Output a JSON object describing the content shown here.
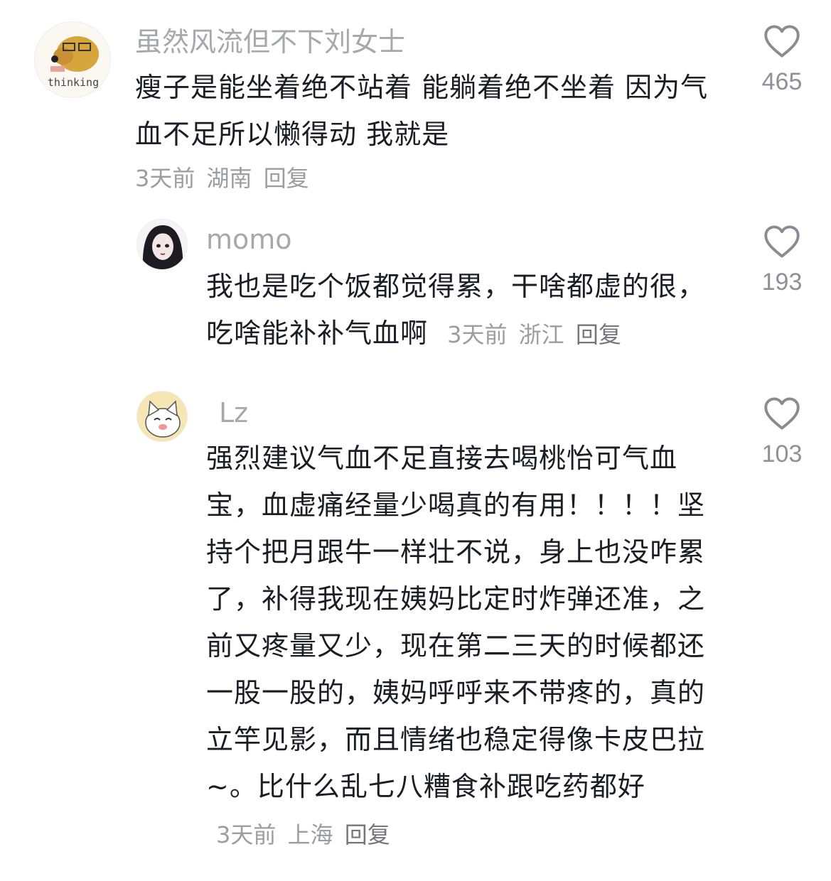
{
  "comments": [
    {
      "username": "虽然风流但不下刘女士",
      "avatar_text": "thinking",
      "text": "瘦子是能坐着绝不站着 能躺着绝不坐着  因为气血不足所以懒得动  我就是",
      "time": "3天前",
      "location": "湖南",
      "reply_label": "回复",
      "likes": "465"
    },
    {
      "username": "momo",
      "text": "我也是吃个饭都觉得累，干啥都虚的很，吃啥能补补气血啊",
      "time": "3天前",
      "location": "浙江",
      "reply_label": "回复",
      "likes": "193"
    },
    {
      "username": "Lz",
      "text": "强烈建议气血不足直接去喝桃怡可气血宝，血虚痛经量少喝真的有用！！！！坚持个把月跟牛一样壮不说，身上也没咋累了，补得我现在姨妈比定时炸弹还准，之前又疼量又少，现在第二三天的时候都还一股一股的，姨妈呼呼来不带疼的，真的立竿见影，而且情绪也稳定得像卡皮巴拉~。比什么乱七八糟食补跟吃药都好",
      "time": "3天前",
      "location": "上海",
      "reply_label": "回复",
      "likes": "103"
    }
  ],
  "colors": {
    "username": "#a7a8ad",
    "text": "#1c1d24",
    "meta": "#9c9ca3",
    "heart": "#8a8b93"
  },
  "icons": {
    "like": "heart-outline-icon"
  }
}
